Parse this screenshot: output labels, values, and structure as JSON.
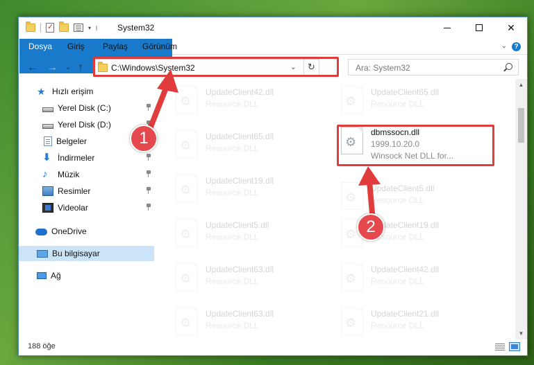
{
  "window": {
    "title": "System32"
  },
  "ribbon": {
    "tabs": [
      "Dosya",
      "Giriş",
      "Paylaş",
      "Görünüm"
    ],
    "help_label": "?"
  },
  "address": {
    "path": "C:\\Windows\\System32"
  },
  "search": {
    "placeholder": "Ara: System32"
  },
  "sidebar": {
    "items": [
      {
        "label": "Hızlı erişim",
        "icon": "star-icon",
        "pinned": false
      },
      {
        "label": "Yerel Disk (C:)",
        "icon": "drive-icon",
        "pinned": true
      },
      {
        "label": "Yerel Disk (D:)",
        "icon": "drive-icon",
        "pinned": true
      },
      {
        "label": "Belgeler",
        "icon": "documents-icon",
        "pinned": true
      },
      {
        "label": "İndirmeler",
        "icon": "downloads-icon",
        "pinned": true
      },
      {
        "label": "Müzik",
        "icon": "music-icon",
        "pinned": true
      },
      {
        "label": "Resimler",
        "icon": "pictures-icon",
        "pinned": true
      },
      {
        "label": "Videolar",
        "icon": "videos-icon",
        "pinned": true
      },
      {
        "label": "OneDrive",
        "icon": "onedrive-icon",
        "pinned": false
      },
      {
        "label": "Bu bilgisayar",
        "icon": "this-pc-icon",
        "pinned": false,
        "selected": true
      },
      {
        "label": "Ağ",
        "icon": "network-icon",
        "pinned": false
      }
    ]
  },
  "files": {
    "left": [
      {
        "name": "UpdateClient42.dll",
        "desc": "Resource DLL"
      },
      {
        "name": "UpdateClient65.dll",
        "desc": "Resource DLL"
      },
      {
        "name": "UpdateClient19.dll",
        "desc": "Resource DLL"
      },
      {
        "name": "UpdateClient5.dll",
        "desc": "Resource DLL"
      },
      {
        "name": "UpdateClient63.dll",
        "desc": "Resource DLL"
      },
      {
        "name": "UpdateClient63.dll",
        "desc": "Resource DLL"
      }
    ],
    "right": [
      {
        "name": "UpdateClient65.dll",
        "desc": "Resource DLL"
      },
      {
        "name": "UpdateClient5.dll",
        "desc": "Resource DLL"
      },
      {
        "name": "UpdateClient19.dll",
        "desc": "Resource DLL"
      },
      {
        "name": "UpdateClient42.dll",
        "desc": "Resource DLL"
      },
      {
        "name": "UpdateClient21.dll",
        "desc": "Resource DLL"
      }
    ],
    "highlighted": {
      "name": "dbmssocn.dll",
      "version": "1999.10.20.0",
      "desc": "Winsock Net DLL for..."
    }
  },
  "status": {
    "item_count": "188 öğe"
  },
  "annotations": {
    "badge1": "1",
    "badge2": "2",
    "color": "#e03c3c"
  }
}
